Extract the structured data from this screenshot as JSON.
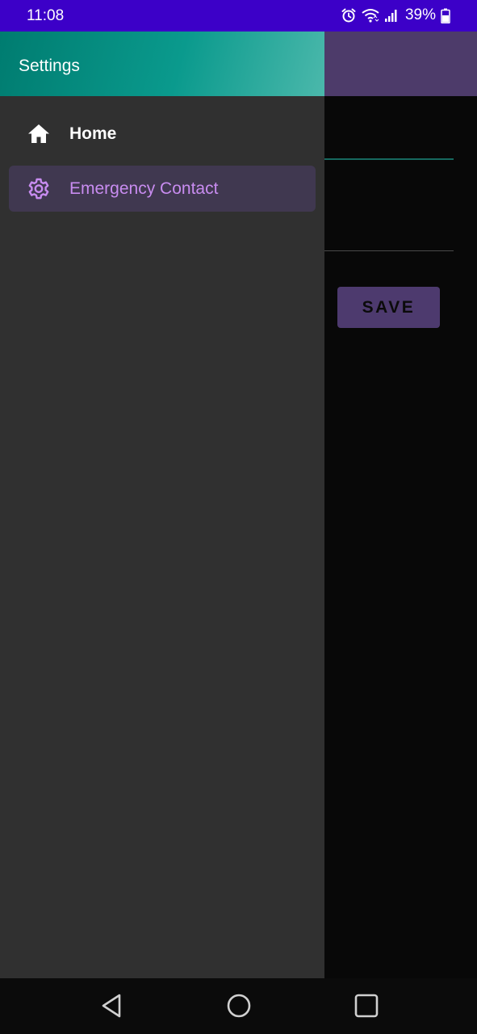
{
  "status_bar": {
    "time": "11:08",
    "battery_percent": "39%",
    "icons": [
      "alarm-icon",
      "wifi-icon",
      "signal-icon",
      "battery-icon"
    ]
  },
  "drawer": {
    "header_title": "Settings",
    "items": [
      {
        "label": "Home",
        "icon": "home-icon",
        "selected": false
      },
      {
        "label": "Emergency Contact",
        "icon": "gear-icon",
        "selected": true
      }
    ]
  },
  "background": {
    "save_label": "SAVE"
  },
  "nav_bar": {
    "buttons": [
      "back-icon",
      "home-circle-icon",
      "recents-icon"
    ]
  },
  "colors": {
    "status_bar": "#3c00c8",
    "drawer_header": "#0a9a8d",
    "toolbar": "#4d3b6a",
    "accent_purple": "#c88cf0",
    "drawer_bg": "#303030"
  }
}
